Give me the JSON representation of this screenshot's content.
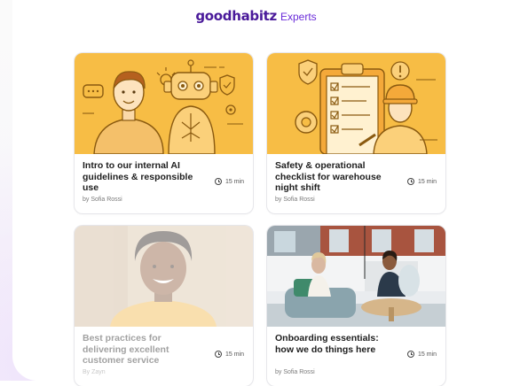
{
  "header": {
    "logo": "goodhabitz",
    "product": "Experts"
  },
  "colors": {
    "brand": "#4a1a9a",
    "accent": "#6a2bd9",
    "card_yellow": "#f7bd45"
  },
  "courses": [
    {
      "title": "Intro to our internal AI guidelines & responsible use",
      "author": "by Sofia Rossi",
      "duration": "15 min",
      "thumbnail": "person-with-robot-illustration"
    },
    {
      "title": "Safety & operational checklist for warehouse night shift",
      "author": "by Sofia Rossi",
      "duration": "15 min",
      "thumbnail": "clipboard-checklist-worker-illustration"
    },
    {
      "title": "Best practices for delivering excellent customer service",
      "author": "By Zayn",
      "duration": "15 min",
      "thumbnail": "smiling-woman-photo"
    },
    {
      "title": "Onboarding essentials: how we do things here",
      "author": "by Sofia Rossi",
      "duration": "15 min",
      "thumbnail": "office-lounge-meeting-photo"
    }
  ]
}
